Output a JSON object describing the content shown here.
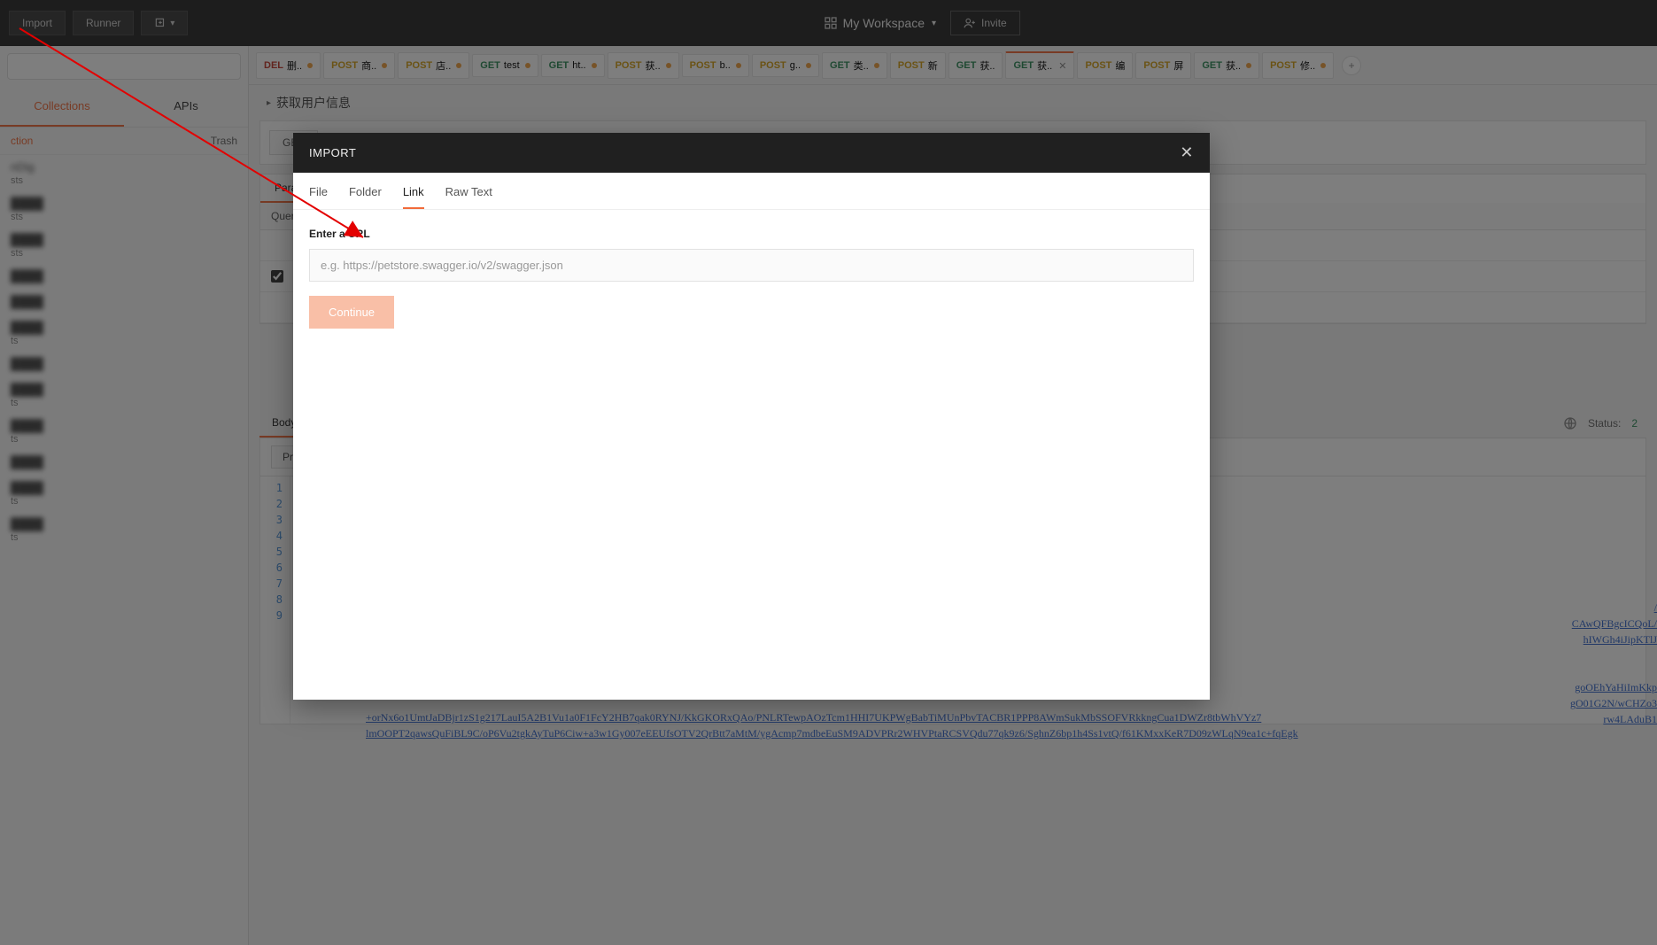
{
  "topbar": {
    "import": "Import",
    "runner": "Runner",
    "workspace": "My Workspace",
    "invite": "Invite"
  },
  "sidebar": {
    "tabs": {
      "collections": "Collections",
      "apis": "APIs"
    },
    "new_collection": "ction",
    "trash": "Trash",
    "items": [
      {
        "title": "nDig",
        "sub": "sts"
      },
      {
        "title": "",
        "sub": "sts"
      },
      {
        "title": "",
        "sub": "sts"
      },
      {
        "title": "",
        "sub": ""
      },
      {
        "title": "",
        "sub": ""
      },
      {
        "title": "",
        "sub": "ts"
      },
      {
        "title": "",
        "sub": ""
      },
      {
        "title": "",
        "sub": "ts"
      },
      {
        "title": "",
        "sub": "ts"
      },
      {
        "title": "",
        "sub": ""
      },
      {
        "title": "",
        "sub": "ts"
      },
      {
        "title": "",
        "sub": "ts"
      }
    ]
  },
  "tabs": [
    {
      "method": "DEL",
      "cls": "m-DEL",
      "label": "删..",
      "dirty": true
    },
    {
      "method": "POST",
      "cls": "m-POST",
      "label": "商..",
      "dirty": true
    },
    {
      "method": "POST",
      "cls": "m-POST",
      "label": "店..",
      "dirty": true
    },
    {
      "method": "GET",
      "cls": "m-GET",
      "label": "test",
      "dirty": true
    },
    {
      "method": "GET",
      "cls": "m-GET",
      "label": "ht..",
      "dirty": true
    },
    {
      "method": "POST",
      "cls": "m-POST",
      "label": "获..",
      "dirty": true
    },
    {
      "method": "POST",
      "cls": "m-POST",
      "label": "b..",
      "dirty": true
    },
    {
      "method": "POST",
      "cls": "m-POST",
      "label": "g..",
      "dirty": true
    },
    {
      "method": "GET",
      "cls": "m-GET",
      "label": "类..",
      "dirty": true
    },
    {
      "method": "POST",
      "cls": "m-POST",
      "label": "新",
      "dirty": false
    },
    {
      "method": "GET",
      "cls": "m-GET",
      "label": "获..",
      "dirty": false
    },
    {
      "method": "GET",
      "cls": "m-GET",
      "label": "获..",
      "active": true,
      "close": true
    },
    {
      "method": "POST",
      "cls": "m-POST",
      "label": "编",
      "dirty": false
    },
    {
      "method": "POST",
      "cls": "m-POST",
      "label": "屏",
      "dirty": false
    },
    {
      "method": "GET",
      "cls": "m-GET",
      "label": "获..",
      "dirty": true
    },
    {
      "method": "POST",
      "cls": "m-POST",
      "label": "修..",
      "dirty": true
    }
  ],
  "breadcrumb": "获取用户信息",
  "builder": {
    "method": "GET",
    "section_tabs": {
      "params": "Para",
      "query_header": "Query"
    }
  },
  "response": {
    "body_tab": "Body",
    "pretty": "Pret",
    "status_label": "Status:",
    "status_value": "2",
    "line_nums": [
      "1",
      "2",
      "3",
      "4",
      "5",
      "6",
      "7",
      "8",
      "9"
    ],
    "code_lines": [
      "",
      "",
      "",
      "",
      "",
      "",
      "",
      "",
      ""
    ],
    "trail1": "+orNx6o1UmtJaDBjr1zS1g217LauI5A2B1Vu1a0F1FcY2HB7qak0RYNJ/KkGKORxQAo/PNLRTewpAOzTcm1HHI7UKPWgBabTiMUnPbvTACBR1PPP8AWmSukMbSSOFVRkkngCua1DWZr8tbWhVYz7",
    "trail2": "lmOOPT2qawsQuFiBL9C/oP6Vu2tgkAyTuP6Ciw+a3w1Gy007eEEUfsOTV2QrBtt7aMtM/ygAcmp7mdbeEuSM9ADVPRr2WHVPtaRCSVQdu77qk9z6/SghnZ6bp1h4Ss1vtQ/f61KMxxKeR7D09zWLqN9ea1c+fqEgk",
    "trail_a": "/",
    "trail_b": "CAwQFBgcICQoL/",
    "trail_c": "hIWGh4iJipKTlJ",
    "trail_d": "goOEhYaHiImKkp",
    "trail_e": "gO01G2N/wCHZo3",
    "trail_f": "rw4LAduB1"
  },
  "modal": {
    "title": "IMPORT",
    "tabs": {
      "file": "File",
      "folder": "Folder",
      "link": "Link",
      "raw": "Raw Text"
    },
    "label": "Enter a URL",
    "placeholder": "e.g. https://petstore.swagger.io/v2/swagger.json",
    "continue": "Continue"
  }
}
